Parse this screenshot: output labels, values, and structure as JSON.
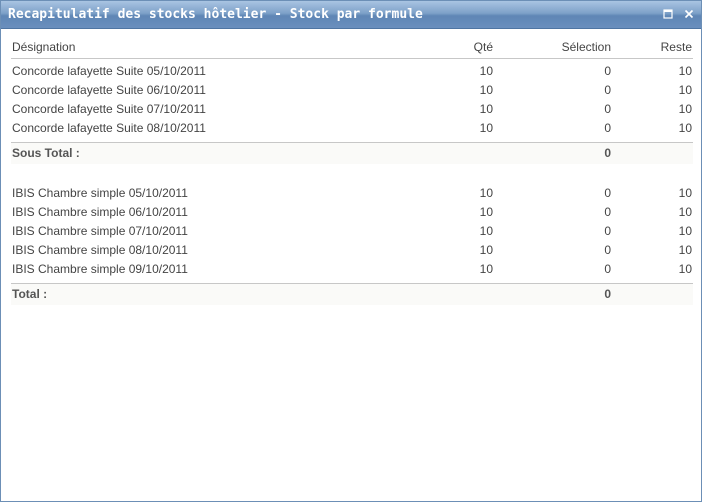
{
  "window": {
    "title": "Recapitulatif des stocks hôtelier - Stock par formule"
  },
  "table": {
    "headers": {
      "designation": "Désignation",
      "qte": "Qté",
      "selection": "Sélection",
      "reste": "Reste"
    },
    "groups": [
      {
        "rows": [
          {
            "designation": "Concorde lafayette Suite 05/10/2011",
            "qte": "10",
            "selection": "0",
            "reste": "10"
          },
          {
            "designation": "Concorde lafayette Suite 06/10/2011",
            "qte": "10",
            "selection": "0",
            "reste": "10"
          },
          {
            "designation": "Concorde lafayette Suite 07/10/2011",
            "qte": "10",
            "selection": "0",
            "reste": "10"
          },
          {
            "designation": "Concorde lafayette Suite 08/10/2011",
            "qte": "10",
            "selection": "0",
            "reste": "10"
          }
        ],
        "subtotal": {
          "label": "Sous Total :",
          "selection": "0"
        }
      },
      {
        "rows": [
          {
            "designation": "IBIS Chambre simple 05/10/2011",
            "qte": "10",
            "selection": "0",
            "reste": "10"
          },
          {
            "designation": "IBIS Chambre simple 06/10/2011",
            "qte": "10",
            "selection": "0",
            "reste": "10"
          },
          {
            "designation": "IBIS Chambre simple 07/10/2011",
            "qte": "10",
            "selection": "0",
            "reste": "10"
          },
          {
            "designation": "IBIS Chambre simple 08/10/2011",
            "qte": "10",
            "selection": "0",
            "reste": "10"
          },
          {
            "designation": "IBIS Chambre simple 09/10/2011",
            "qte": "10",
            "selection": "0",
            "reste": "10"
          }
        ],
        "subtotal": {
          "label": "Total :",
          "selection": "0"
        }
      }
    ]
  },
  "icons": {
    "maximize": "maximize-icon",
    "close": "close-icon"
  },
  "colors": {
    "titlebar": "#6a8fbd",
    "border": "#6c8fb6",
    "text": "#444444"
  }
}
